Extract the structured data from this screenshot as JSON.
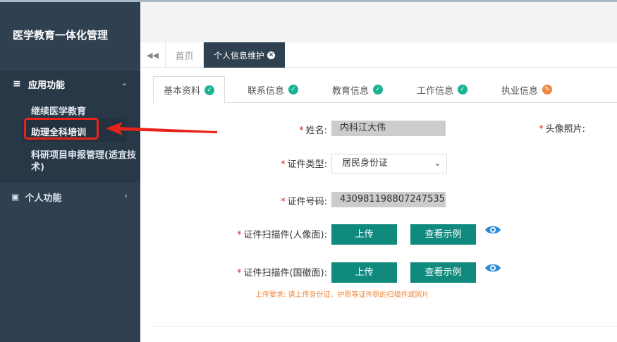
{
  "sidebar": {
    "brand": "医学教育一体化管理",
    "menu_app_label": "应用功能",
    "menu_app_icon": "bars-icon",
    "submenu": [
      "继续医学教育",
      "助理全科培训",
      "科研项目申报管理(适宜技",
      "术)"
    ],
    "menu_personal_label": "个人功能",
    "menu_personal_icon": "id-card-icon"
  },
  "tabs": {
    "home": "首页",
    "active": "个人信息维护"
  },
  "subtabs": [
    {
      "label": "基本资料",
      "status": "ok"
    },
    {
      "label": "联系信息",
      "status": "ok"
    },
    {
      "label": "教育信息",
      "status": "ok"
    },
    {
      "label": "工作信息",
      "status": "ok"
    },
    {
      "label": "执业信息",
      "status": "edit"
    }
  ],
  "form": {
    "required_mark": "*",
    "name_label": "姓名:",
    "name_value": "内科江大伟",
    "photo_label": "头像照片:",
    "id_type_label": "证件类型:",
    "id_type_value": "居民身份证",
    "id_number_label": "证件号码:",
    "id_number_value": "430981198807247535",
    "scan_front_label": "证件扫描件(人像面):",
    "scan_back_label": "证件扫描件(国徽面):",
    "upload_label": "上传",
    "sample_label": "查看示例",
    "hint": "上传要求: 请上传身份证、护照等证件照的扫描件或照片"
  },
  "colors": {
    "sidebar": "#2f4050",
    "primary_button": "#118a7e",
    "success": "#1ab394",
    "warning": "#f0883e",
    "annotation": "#e8231a"
  }
}
